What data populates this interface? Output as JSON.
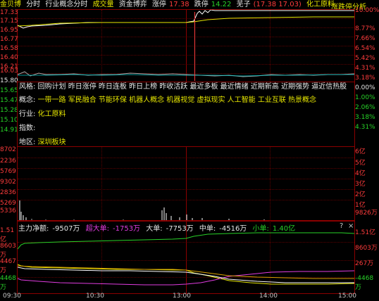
{
  "topbar": {
    "stock_name": "金贝博",
    "tab_intraday": "分时",
    "tab_industry": "行业概念分时",
    "tab_volume": "成交量",
    "tab_fund": "资金博弈",
    "limit_up_label": "涨停",
    "limit_up_value": "17.38",
    "limit_down_label": "跌停",
    "limit_down_value": "14.22",
    "child_label": "芜子",
    "child_values": "(17.38 17.03)",
    "industry": "化工原料",
    "analysis": "涨跌停分析"
  },
  "price_axis": {
    "left": [
      "17.33",
      "17.15",
      "16.95",
      "16.77",
      "16.58",
      "16.40",
      "16.21",
      "16.03",
      "15.80",
      "15.65",
      "15.47",
      "15.28",
      "15.10",
      "14.91"
    ],
    "right": [
      "10.00%",
      "8.77%",
      "7.66%",
      "6.54%",
      "5.42%",
      "4.31%",
      "3.18%",
      "2.06%",
      "1.00%",
      "0.00%",
      "1.00%",
      "2.06%",
      "3.18%",
      "4.31%"
    ]
  },
  "info": {
    "style_line": "风格: 回购计划 昨日涨停 昨日连板 昨日上榜 昨收活跃 最近多板 最近情绪 近期新高 近期强势 逼近信热股",
    "concept_label": "概念:",
    "concept_value": "一带一路 军民融合 节能环保 机器人概念 机器视觉 虚拟现实 人工智能 工业互联 热景概念",
    "industry_label": "行业:",
    "industry_value": "化工原料",
    "index_label": "指数:",
    "region_label": "地区:",
    "region_value": "深圳板块"
  },
  "volume_axis": {
    "left": [
      "8702",
      "2236",
      "5769",
      "9302",
      "2836",
      "5269",
      "5336"
    ],
    "right": [
      "6亿",
      "5亿",
      "4亿",
      "3亿",
      "2亿",
      "1亿",
      "9826万"
    ]
  },
  "flow": {
    "main_label": "主力净额:",
    "main_value": "-9507万",
    "super_label": "超大单:",
    "super_value": "-1753万",
    "big_label": "大单:",
    "big_value": "-7753万",
    "mid_label": "中单:",
    "mid_value": "-4516万",
    "small_label": "小单:",
    "small_value": "1.40亿",
    "ctrl_question": "?",
    "ctrl_close": "×",
    "axis_left": [
      "1.51亿",
      "8603万",
      "4467万",
      "4468万"
    ],
    "axis_right": [
      "1.51亿",
      "8603万",
      "267万",
      "-4468万"
    ]
  },
  "time_axis": [
    "09:30",
    "10:30",
    "13:00",
    "14:00",
    "15:00"
  ],
  "colors": {
    "up": "#ff3c3c",
    "down": "#28d228",
    "price_line": "#ffffff",
    "avg_line": "#e6e600",
    "grid": "#8b0000"
  }
}
